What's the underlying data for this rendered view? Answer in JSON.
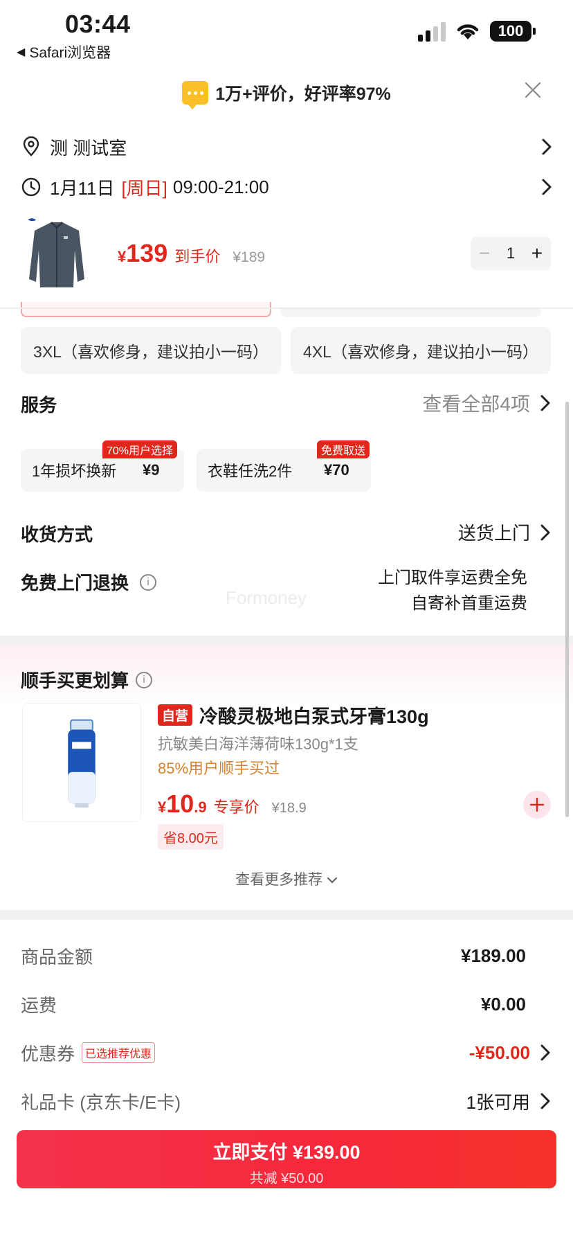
{
  "status_bar": {
    "time": "03:44",
    "back_app": "Safari浏览器",
    "battery": "100"
  },
  "review_banner": {
    "text": "1万+评价，好评率97%"
  },
  "address": {
    "label": "测 测试室"
  },
  "delivery_time": {
    "date": "1月11日",
    "weekday": "[周日]",
    "hours": "09:00-21:00"
  },
  "product": {
    "currency": "¥",
    "price": "139",
    "price_tag": "到手价",
    "original_price": "¥189",
    "quantity": "1",
    "qty_minus": "−",
    "qty_plus": "+"
  },
  "sizes": [
    {
      "label": "3XL（喜欢修身，建议拍小一码）"
    },
    {
      "label": "4XL（喜欢修身，建议拍小一码）"
    }
  ],
  "services": {
    "title": "服务",
    "view_all": "查看全部4项",
    "items": [
      {
        "name": "1年损坏换新",
        "price": "¥9",
        "badge": "70%用户选择"
      },
      {
        "name": "衣鞋任洗2件",
        "price": "¥70",
        "badge": "免费取送"
      }
    ]
  },
  "shipping": {
    "title": "收货方式",
    "value": "送货上门"
  },
  "free_return": {
    "title": "免费上门退换",
    "line1": "上门取件享运费全免",
    "line2": "自寄补首重运费"
  },
  "watermark": "Formoney",
  "recommend": {
    "title": "顺手买更划算",
    "badge": "自营",
    "name": "冷酸灵极地白泵式牙膏130g",
    "spec": "抗敏美白海洋薄荷味130g*1支",
    "users": "85%用户顺手买过",
    "currency": "¥",
    "price_int": "10",
    "price_dec": ".9",
    "price_tag": "专享价",
    "original_price": "¥18.9",
    "save": "省8.00元",
    "more": "查看更多推荐"
  },
  "summary": {
    "goods_label": "商品金额",
    "goods_value": "¥189.00",
    "freight_label": "运费",
    "freight_value": "¥0.00",
    "coupon_label": "优惠券",
    "coupon_badge": "已选推荐优惠",
    "coupon_value": "-¥50.00",
    "giftcard_label": "礼品卡 (京东卡/E卡)",
    "giftcard_value": "1张可用"
  },
  "pay": {
    "main": "立即支付 ¥139.00",
    "sub": "共减 ¥50.00"
  },
  "colors": {
    "accent": "#e0271b",
    "pay_button": "#f6283a",
    "coupon_orange": "#d9822b",
    "review_icon": "#f9c127"
  },
  "icons": [
    "location-pin-icon",
    "clock-icon",
    "chevron-right-icon",
    "close-icon",
    "chat-bubble-icon",
    "info-icon",
    "plus-icon",
    "chevron-down-icon",
    "wifi-icon",
    "signal-icon",
    "battery-icon"
  ]
}
